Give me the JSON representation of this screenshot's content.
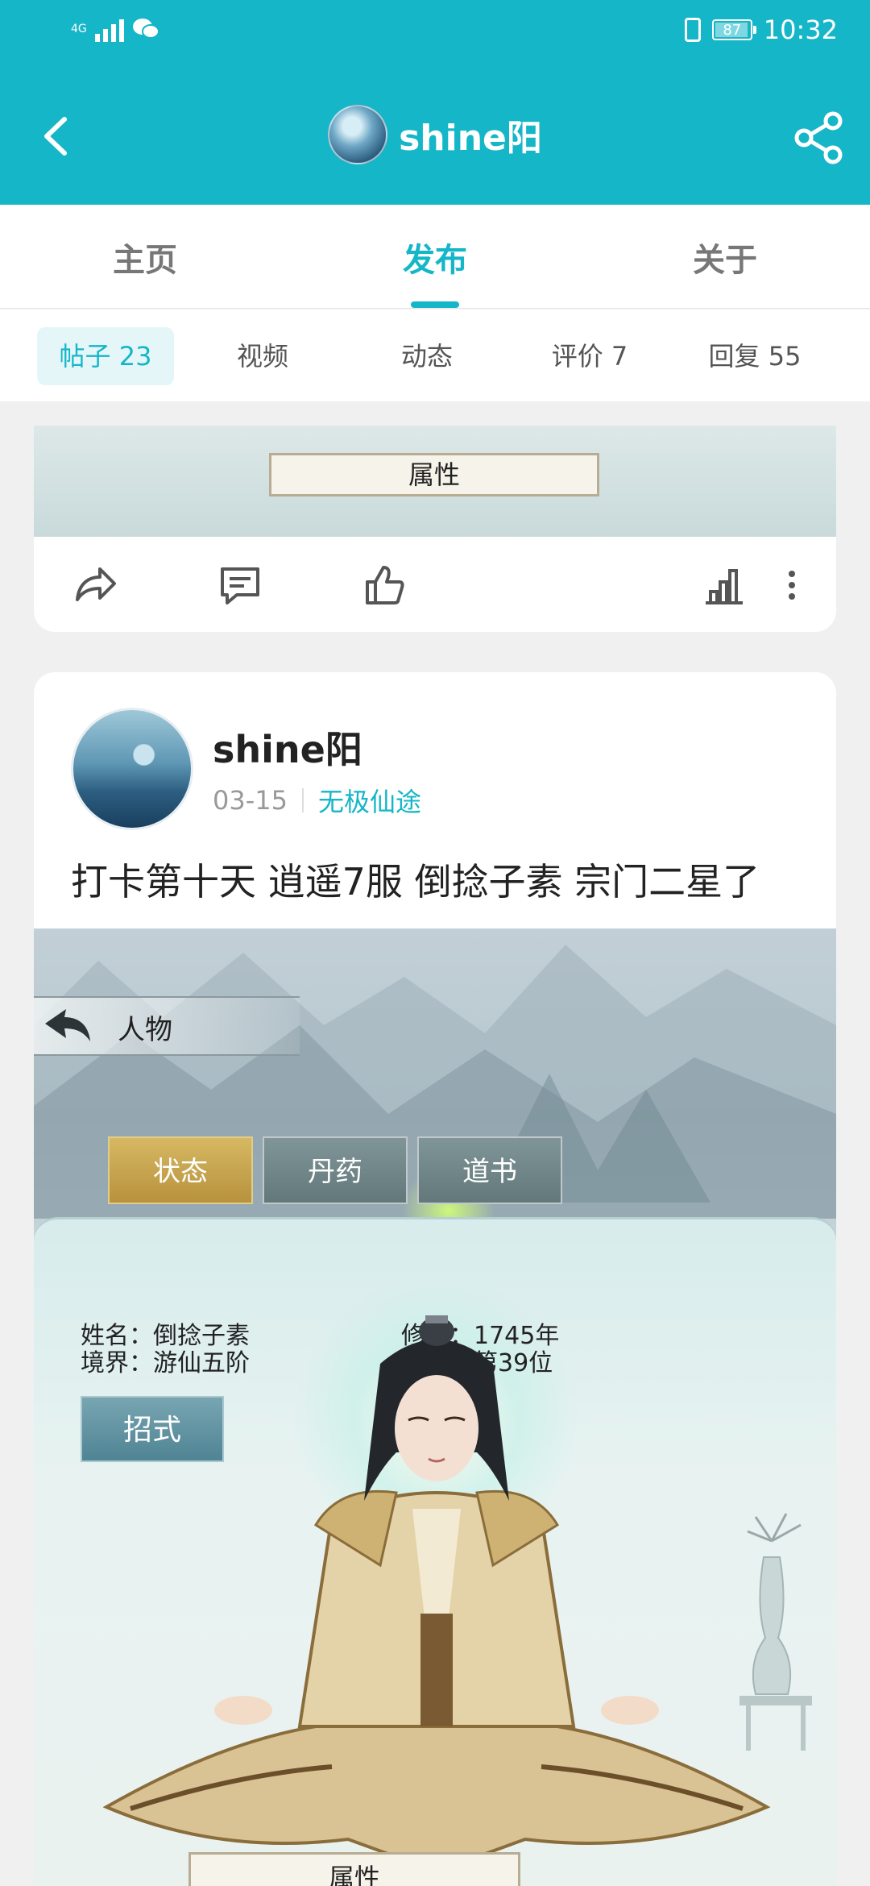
{
  "status_bar": {
    "network": "4G",
    "battery": "87",
    "time": "10:32"
  },
  "header": {
    "title": "shine阳"
  },
  "main_tabs": [
    {
      "label": "主页"
    },
    {
      "label": "发布"
    },
    {
      "label": "关于"
    }
  ],
  "sub_tabs": [
    {
      "label": "帖子 23"
    },
    {
      "label": "视频"
    },
    {
      "label": "动态"
    },
    {
      "label": "评价 7"
    },
    {
      "label": "回复 55"
    }
  ],
  "card1": {
    "image_plate": "属性"
  },
  "post": {
    "username": "shine阳",
    "date": "03-15",
    "game": "无极仙途",
    "text": "打卡第十天 逍遥7服 倒捻子素 宗门二星了"
  },
  "game_screenshot": {
    "header": "人物",
    "tabs": [
      "状态",
      "丹药",
      "道书"
    ],
    "name": "姓名：倒捻子素",
    "realm": "境界：游仙五阶",
    "cultivation": "修炼：1745年",
    "ascension": "飞升：第39位",
    "skill_button": "招式",
    "plate": "属性"
  },
  "colors": {
    "accent": "#15b6c8",
    "gold": "#c9a54d"
  },
  "icons": {
    "back": "chevron-left-icon",
    "share": "share-icon",
    "forward": "forward-icon",
    "comment": "comment-icon",
    "like": "thumbs-up-icon",
    "stats": "bar-chart-icon",
    "more": "more-vertical-icon"
  }
}
